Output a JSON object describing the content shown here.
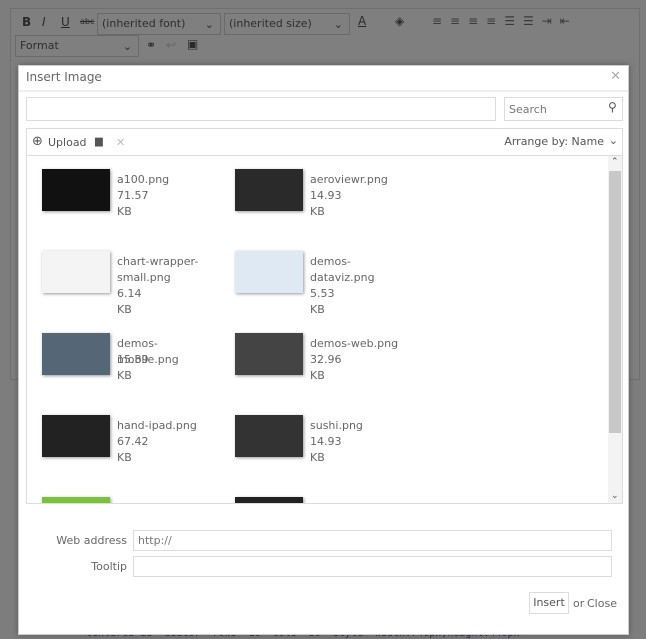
{
  "editor": {
    "toolbar": {
      "bold": "B",
      "italic": "I",
      "underline": "U",
      "strike": "abc",
      "font": "(inherited font)",
      "size": "(inherited size)",
      "color": "A",
      "format": "Format"
    },
    "code": "<textarea id=\"editor\" rows=\"10\" cols=\"30\" style=\"width:740px;height:440px\">"
  },
  "dialog": {
    "title": "Insert Image",
    "path_value": "",
    "search_placeholder": "Search",
    "upload_label": "Upload",
    "arrange_label": "Arrange by: Name",
    "files": [
      {
        "name": "a100.png",
        "size": "71.57 KB",
        "thumb": "#111111"
      },
      {
        "name": "aeroviewr.png",
        "size": "14.93 KB",
        "thumb": "#2a2a2a"
      },
      {
        "name": "chart-wrapper-small.png",
        "size": "6.14 KB",
        "thumb": "#f4f4f4"
      },
      {
        "name": "demos-dataviz.png",
        "size": "5.53 KB",
        "thumb": "#dfe9f3"
      },
      {
        "name": "demos-mobile.png",
        "size": "15.89 KB",
        "thumb": "#556677"
      },
      {
        "name": "demos-web.png",
        "size": "32.96 KB",
        "thumb": "#444444"
      },
      {
        "name": "hand-ipad.png",
        "size": "67.42 KB",
        "thumb": "#222222"
      },
      {
        "name": "sushi.png",
        "size": "14.93 KB",
        "thumb": "#333333"
      },
      {
        "name": "",
        "size": "",
        "thumb": "#7bc23a"
      },
      {
        "name": "",
        "size": "",
        "thumb": "#222222"
      }
    ],
    "web_address_label": "Web address",
    "web_address_value": "http://",
    "tooltip_label": "Tooltip",
    "tooltip_value": "",
    "insert_label": "Insert",
    "or_label": "or",
    "close_label": "Close"
  }
}
